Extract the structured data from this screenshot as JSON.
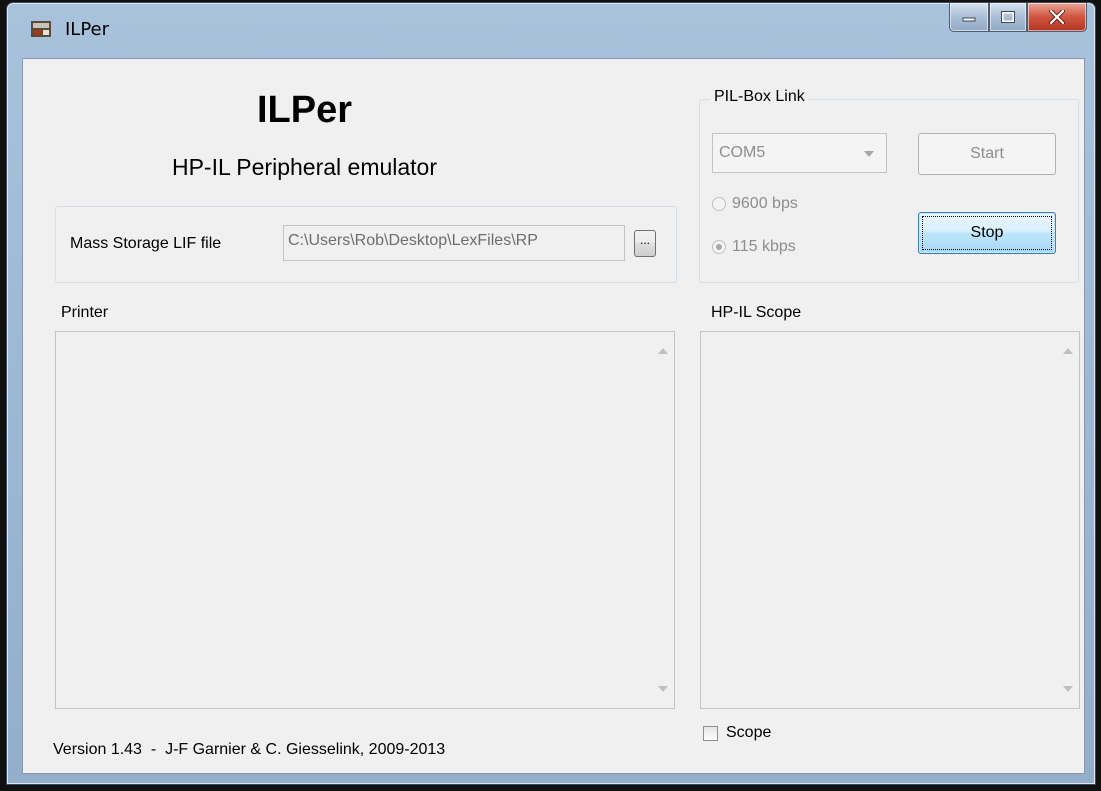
{
  "window": {
    "title": "ILPer",
    "icon": "ilper-app-icon",
    "controls": [
      "minimize-icon",
      "maximize-icon",
      "close-icon"
    ]
  },
  "header": {
    "title": "ILPer",
    "subtitle": "HP-IL Peripheral emulator"
  },
  "mass_storage": {
    "label": "Mass Storage LIF file",
    "path": "C:\\Users\\Rob\\Desktop\\LexFiles\\RP",
    "browse_label": "..."
  },
  "pilbox": {
    "group_label": "PIL-Box Link",
    "port_value": "COM5",
    "start_label": "Start",
    "stop_label": "Stop",
    "speeds": [
      {
        "label": "9600 bps",
        "checked": false
      },
      {
        "label": "115 kbps",
        "checked": true
      }
    ]
  },
  "printer": {
    "label": "Printer"
  },
  "scope": {
    "label": "HP-IL Scope",
    "checkbox_label": "Scope",
    "checked": false
  },
  "footer": {
    "version_text": "Version 1.43  -  J-F Garnier & C. Giesselink, 2009-2013"
  },
  "colors": {
    "title_bar": "#9bb6d2",
    "client_bg": "#f0f0f0",
    "close_button": "#c9462f"
  }
}
